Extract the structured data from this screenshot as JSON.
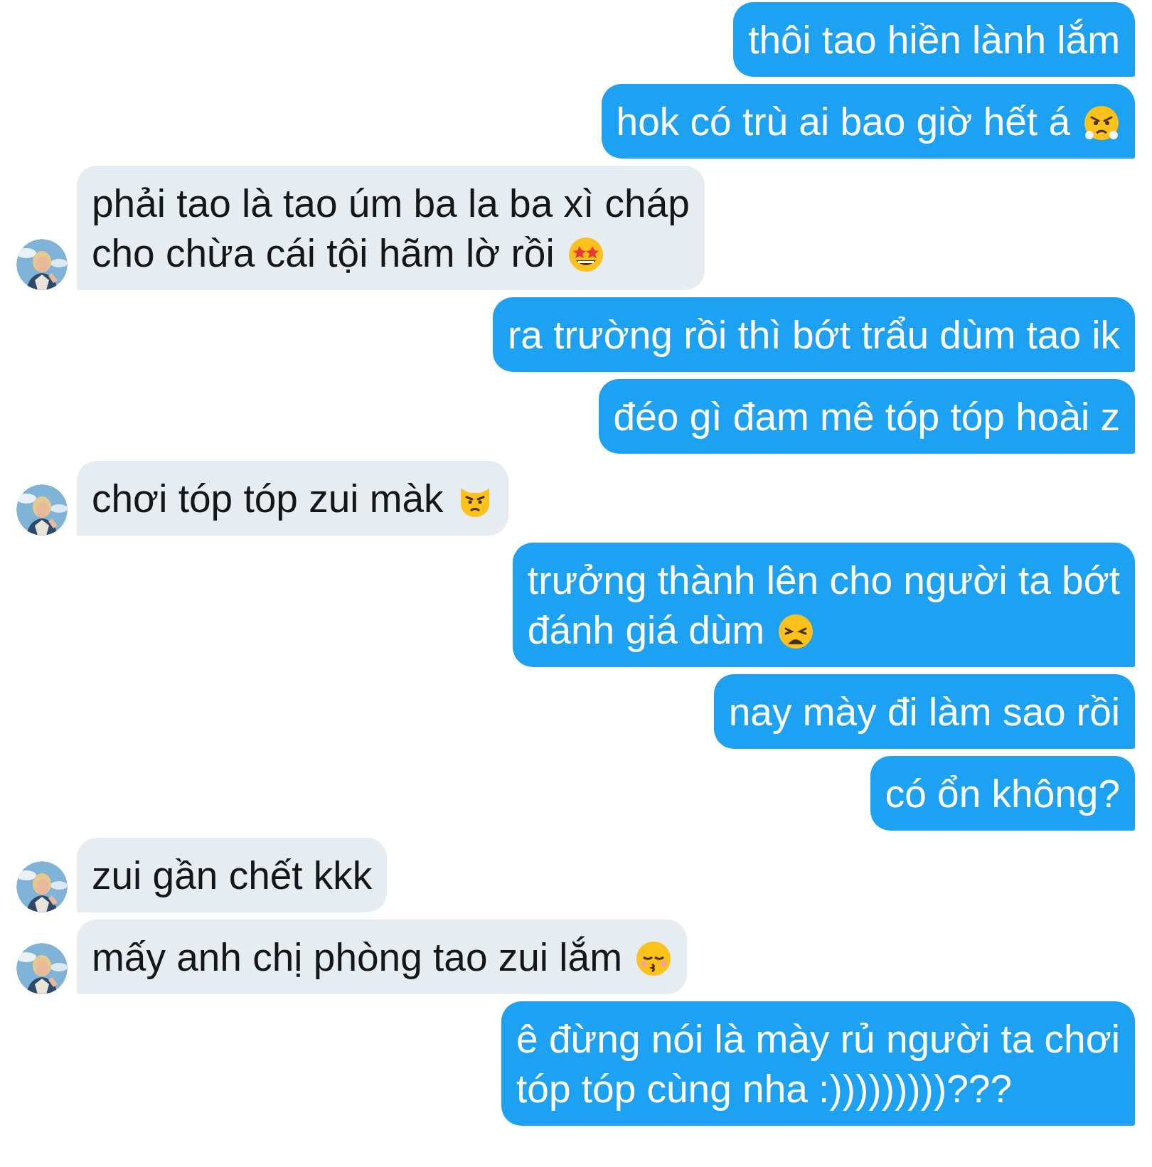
{
  "messages": [
    {
      "kind": "outgoing",
      "lines": [
        "thôi tao hiền lành lắm"
      ]
    },
    {
      "kind": "outgoing",
      "lines": [
        "hok có trù ai bao giờ hết á"
      ],
      "emoji": {
        "kind": "huffing"
      }
    },
    {
      "kind": "incoming",
      "lines": [
        "phải tao là tao úm ba la ba xì cháp",
        "cho chừa cái tội hãm lờ rồi"
      ],
      "emoji": {
        "kind": "star-struck"
      }
    },
    {
      "kind": "outgoing",
      "lines": [
        "ra trường rồi thì bớt trẩu dùm tao ik"
      ]
    },
    {
      "kind": "outgoing",
      "lines": [
        "đéo gì đam mê tóp tóp hoài z"
      ]
    },
    {
      "kind": "incoming",
      "lines": [
        "chơi tóp tóp zui màk"
      ],
      "emoji": {
        "kind": "pouting-cat"
      }
    },
    {
      "kind": "outgoing",
      "lines": [
        "trưởng thành lên cho người ta bớt",
        "đánh giá dùm"
      ],
      "emoji": {
        "kind": "weary"
      }
    },
    {
      "kind": "outgoing",
      "lines": [
        "nay mày đi làm sao rồi"
      ]
    },
    {
      "kind": "outgoing",
      "lines": [
        "có ổn không?"
      ]
    },
    {
      "kind": "incoming",
      "lines": [
        "zui gần chết kkk"
      ]
    },
    {
      "kind": "incoming",
      "lines": [
        "mấy anh chị phòng tao zui lắm"
      ],
      "emoji": {
        "kind": "kissing"
      }
    },
    {
      "kind": "outgoing",
      "lines": [
        "ê đừng nói là mày rủ người ta chơi",
        "tóp tóp cùng nha :)))))))))???"
      ]
    }
  ]
}
